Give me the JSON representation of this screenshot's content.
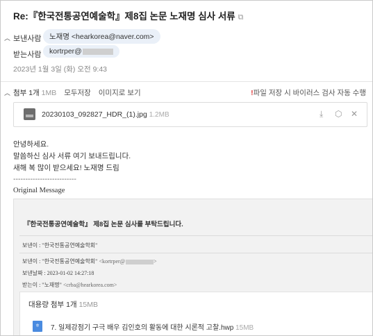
{
  "mail": {
    "subject": "Re:『한국전통공연예술학』제8집 논문 노재명 심사 서류",
    "external_icon": "external-link-icon",
    "sender_label": "보낸사람",
    "sender_chip": "노재명 <hearkorea@naver.com>",
    "recipient_label": "받는사람",
    "recipient_chip": "kortrper@",
    "date": "2023년 1월 3일 (화) 오전 9:43"
  },
  "attachments": {
    "label": "첨부 1개",
    "size": "1MB",
    "save_all": "모두저장",
    "view_images": "이미지로 보기",
    "virus_note": "파일 저장 시 바이러스 검사 자동 수행",
    "file_name": "20230103_092827_HDR_(1).jpg",
    "file_size": "1.2MB"
  },
  "body": {
    "line1": "안녕하세요.",
    "line2": "말씀하신 심사 서류 여기 보내드립니다.",
    "line3": "새해 복 많이 받으세요! 노재명 드림",
    "separator": "--------------------------",
    "original_label": "Original Message"
  },
  "quoted": {
    "title": "『한국전통공연예술학』 제8집 논문 심사를 부탁드립니다.",
    "from_top": "보낸이 : \"한국전통공연예술학회\"",
    "from_label": "보낸이 : \"한국전통공연예술학회\"",
    "from_addr": "<kortrper@",
    "from_close": ">",
    "date_line": "보낸날짜 : 2023-01-02 14:27:18",
    "to_line": "받는이 : \"노재명\"",
    "to_addr": "<crba@hearkorea.com>",
    "big_attach_label": "대용량 첨부 1개",
    "big_attach_size": "15MB",
    "big_file_name": "7. 일제강점기 구극 배우 김인호의 활동에 대한 시론적 고찰.hwp",
    "big_file_size": "15MB",
    "hwp_icon_text": "ㅎ"
  },
  "colors": {
    "chip_bg": "#eaf0f8",
    "warning_red": "#e03b3b",
    "quote_bg": "#f2f2f2",
    "hwp_blue": "#4a8be0"
  }
}
